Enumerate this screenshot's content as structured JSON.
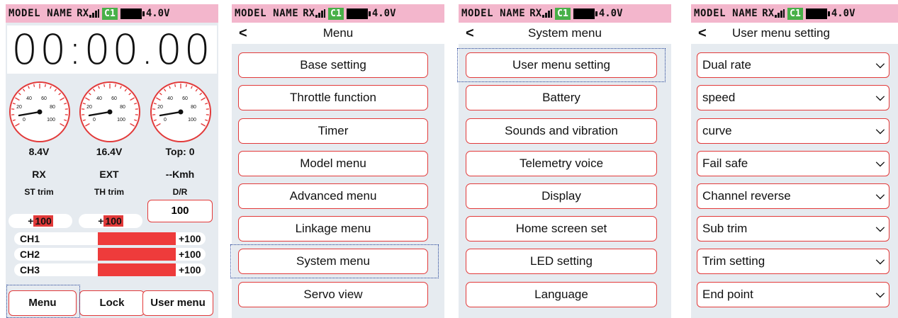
{
  "status": {
    "model_name": "MODEL NAME",
    "rx": "RX",
    "channel": "C1",
    "voltage": "4.0V"
  },
  "home": {
    "timer": "00:00.00",
    "gauge_ticks": [
      "20",
      "40",
      "60",
      "80",
      "100",
      "0"
    ],
    "readings": [
      "8.4V",
      "16.4V",
      "Top",
      "0"
    ],
    "top_sep": ":",
    "sources": [
      "RX",
      "EXT",
      "--Kmh"
    ],
    "trim_labels": [
      "ST trim",
      "TH trim",
      "D/R"
    ],
    "st_trim": {
      "sign": "+",
      "value": "100"
    },
    "th_trim": {
      "sign": "+",
      "value": "100"
    },
    "dr_value": "100",
    "channels": [
      {
        "label": "CH1",
        "value": "+100",
        "level": 1.0
      },
      {
        "label": "CH2",
        "value": "+100",
        "level": 1.0
      },
      {
        "label": "CH3",
        "value": "+100",
        "level": 1.0
      }
    ],
    "buttons": [
      "Menu",
      "Lock",
      "User menu"
    ]
  },
  "menu": {
    "back": "<",
    "title": "Menu",
    "items": [
      "Base setting",
      "Throttle function",
      "Timer",
      "Model menu",
      "Advanced menu",
      "Linkage menu",
      "System menu",
      "Servo view"
    ]
  },
  "system_menu": {
    "back": "<",
    "title": "System menu",
    "items": [
      "User menu setting",
      "Battery",
      "Sounds and vibration",
      "Telemetry voice",
      "Display",
      "Home screen set",
      "LED setting",
      "Language"
    ]
  },
  "user_menu": {
    "back": "<",
    "title": "User menu setting",
    "items": [
      "Dual rate",
      "speed",
      "curve",
      "Fail safe",
      "Channel reverse",
      "Sub trim",
      "Trim setting",
      "End point"
    ]
  },
  "colors": {
    "accent_red": "#e23a3a",
    "status_pink": "#f3b6cc",
    "channel_green": "#48b048",
    "panel_bg": "#e6ebf0"
  }
}
